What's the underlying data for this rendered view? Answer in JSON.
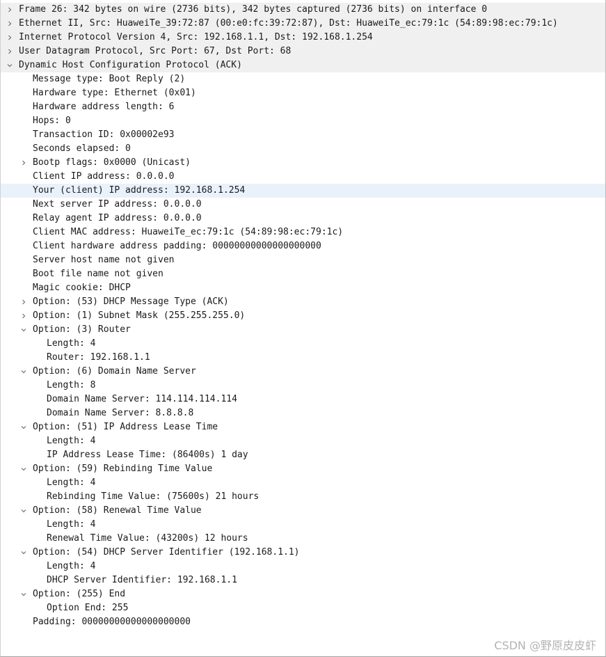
{
  "tree": [
    {
      "text": "Frame 26: 342 bytes on wire (2736 bits), 342 bytes captured (2736 bits) on interface 0",
      "level": 0,
      "toggle": "collapsed",
      "top": true
    },
    {
      "text": "Ethernet II, Src: HuaweiTe_39:72:87 (00:e0:fc:39:72:87), Dst: HuaweiTe_ec:79:1c (54:89:98:ec:79:1c)",
      "level": 0,
      "toggle": "collapsed",
      "top": true
    },
    {
      "text": "Internet Protocol Version 4, Src: 192.168.1.1, Dst: 192.168.1.254",
      "level": 0,
      "toggle": "collapsed",
      "top": true
    },
    {
      "text": "User Datagram Protocol, Src Port: 67, Dst Port: 68",
      "level": 0,
      "toggle": "collapsed",
      "top": true
    },
    {
      "text": "Dynamic Host Configuration Protocol (ACK)",
      "level": 0,
      "toggle": "expanded",
      "top": true
    },
    {
      "text": "Message type: Boot Reply (2)",
      "level": 1,
      "toggle": "none"
    },
    {
      "text": "Hardware type: Ethernet (0x01)",
      "level": 1,
      "toggle": "none"
    },
    {
      "text": "Hardware address length: 6",
      "level": 1,
      "toggle": "none"
    },
    {
      "text": "Hops: 0",
      "level": 1,
      "toggle": "none"
    },
    {
      "text": "Transaction ID: 0x00002e93",
      "level": 1,
      "toggle": "none"
    },
    {
      "text": "Seconds elapsed: 0",
      "level": 1,
      "toggle": "none"
    },
    {
      "text": "Bootp flags: 0x0000 (Unicast)",
      "level": 1,
      "toggle": "collapsed"
    },
    {
      "text": "Client IP address: 0.0.0.0",
      "level": 1,
      "toggle": "none"
    },
    {
      "text": "Your (client) IP address: 192.168.1.254",
      "level": 1,
      "toggle": "none",
      "selected": true
    },
    {
      "text": "Next server IP address: 0.0.0.0",
      "level": 1,
      "toggle": "none"
    },
    {
      "text": "Relay agent IP address: 0.0.0.0",
      "level": 1,
      "toggle": "none"
    },
    {
      "text": "Client MAC address: HuaweiTe_ec:79:1c (54:89:98:ec:79:1c)",
      "level": 1,
      "toggle": "none"
    },
    {
      "text": "Client hardware address padding: 00000000000000000000",
      "level": 1,
      "toggle": "none"
    },
    {
      "text": "Server host name not given",
      "level": 1,
      "toggle": "none"
    },
    {
      "text": "Boot file name not given",
      "level": 1,
      "toggle": "none"
    },
    {
      "text": "Magic cookie: DHCP",
      "level": 1,
      "toggle": "none"
    },
    {
      "text": "Option: (53) DHCP Message Type (ACK)",
      "level": 1,
      "toggle": "collapsed"
    },
    {
      "text": "Option: (1) Subnet Mask (255.255.255.0)",
      "level": 1,
      "toggle": "collapsed"
    },
    {
      "text": "Option: (3) Router",
      "level": 1,
      "toggle": "expanded"
    },
    {
      "text": "Length: 4",
      "level": 2,
      "toggle": "none"
    },
    {
      "text": "Router: 192.168.1.1",
      "level": 2,
      "toggle": "none"
    },
    {
      "text": "Option: (6) Domain Name Server",
      "level": 1,
      "toggle": "expanded"
    },
    {
      "text": "Length: 8",
      "level": 2,
      "toggle": "none"
    },
    {
      "text": "Domain Name Server: 114.114.114.114",
      "level": 2,
      "toggle": "none"
    },
    {
      "text": "Domain Name Server: 8.8.8.8",
      "level": 2,
      "toggle": "none"
    },
    {
      "text": "Option: (51) IP Address Lease Time",
      "level": 1,
      "toggle": "expanded"
    },
    {
      "text": "Length: 4",
      "level": 2,
      "toggle": "none"
    },
    {
      "text": "IP Address Lease Time: (86400s) 1 day",
      "level": 2,
      "toggle": "none"
    },
    {
      "text": "Option: (59) Rebinding Time Value",
      "level": 1,
      "toggle": "expanded"
    },
    {
      "text": "Length: 4",
      "level": 2,
      "toggle": "none"
    },
    {
      "text": "Rebinding Time Value: (75600s) 21 hours",
      "level": 2,
      "toggle": "none"
    },
    {
      "text": "Option: (58) Renewal Time Value",
      "level": 1,
      "toggle": "expanded"
    },
    {
      "text": "Length: 4",
      "level": 2,
      "toggle": "none"
    },
    {
      "text": "Renewal Time Value: (43200s) 12 hours",
      "level": 2,
      "toggle": "none"
    },
    {
      "text": "Option: (54) DHCP Server Identifier (192.168.1.1)",
      "level": 1,
      "toggle": "expanded"
    },
    {
      "text": "Length: 4",
      "level": 2,
      "toggle": "none"
    },
    {
      "text": "DHCP Server Identifier: 192.168.1.1",
      "level": 2,
      "toggle": "none"
    },
    {
      "text": "Option: (255) End",
      "level": 1,
      "toggle": "expanded"
    },
    {
      "text": "Option End: 255",
      "level": 2,
      "toggle": "none"
    },
    {
      "text": "Padding: 00000000000000000000",
      "level": 1,
      "toggle": "none"
    }
  ],
  "watermark": "CSDN @野原皮皮虾",
  "colors": {
    "top_row_bg": "#f0f0f0",
    "selected_row_bg": "#e9f1fb",
    "text": "#1a1a1a",
    "chevron": "#6f6f6f",
    "watermark": "#b3b3b3"
  }
}
